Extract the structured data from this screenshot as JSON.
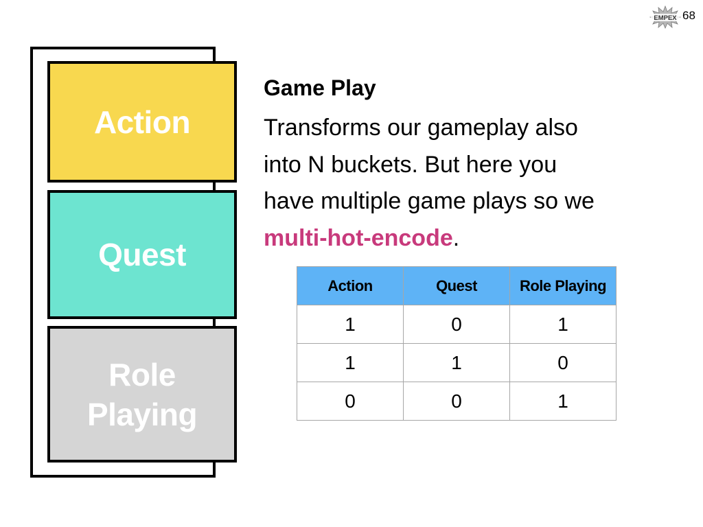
{
  "header": {
    "logo_text": "EMPEX",
    "page_number": "68"
  },
  "stack": {
    "blocks": [
      {
        "label": "Action",
        "color": "#f8d84f"
      },
      {
        "label": "Quest",
        "color": "#6de4d0"
      },
      {
        "label": "Role\nPlaying",
        "color": "#d5d5d5"
      }
    ]
  },
  "content": {
    "heading": "Game Play",
    "lines": [
      "Transforms our gameplay also",
      "into N buckets.  But here you",
      "have multiple game plays so we"
    ],
    "highlight": "multi-hot-encode",
    "highlight_color": "#c83a7c",
    "trailing": "."
  },
  "table": {
    "headers": [
      "Action",
      "Quest",
      "Role Playing"
    ],
    "header_color": "#5eb3f6",
    "rows": [
      [
        "1",
        "0",
        "1"
      ],
      [
        "1",
        "1",
        "0"
      ],
      [
        "0",
        "0",
        "1"
      ]
    ]
  }
}
